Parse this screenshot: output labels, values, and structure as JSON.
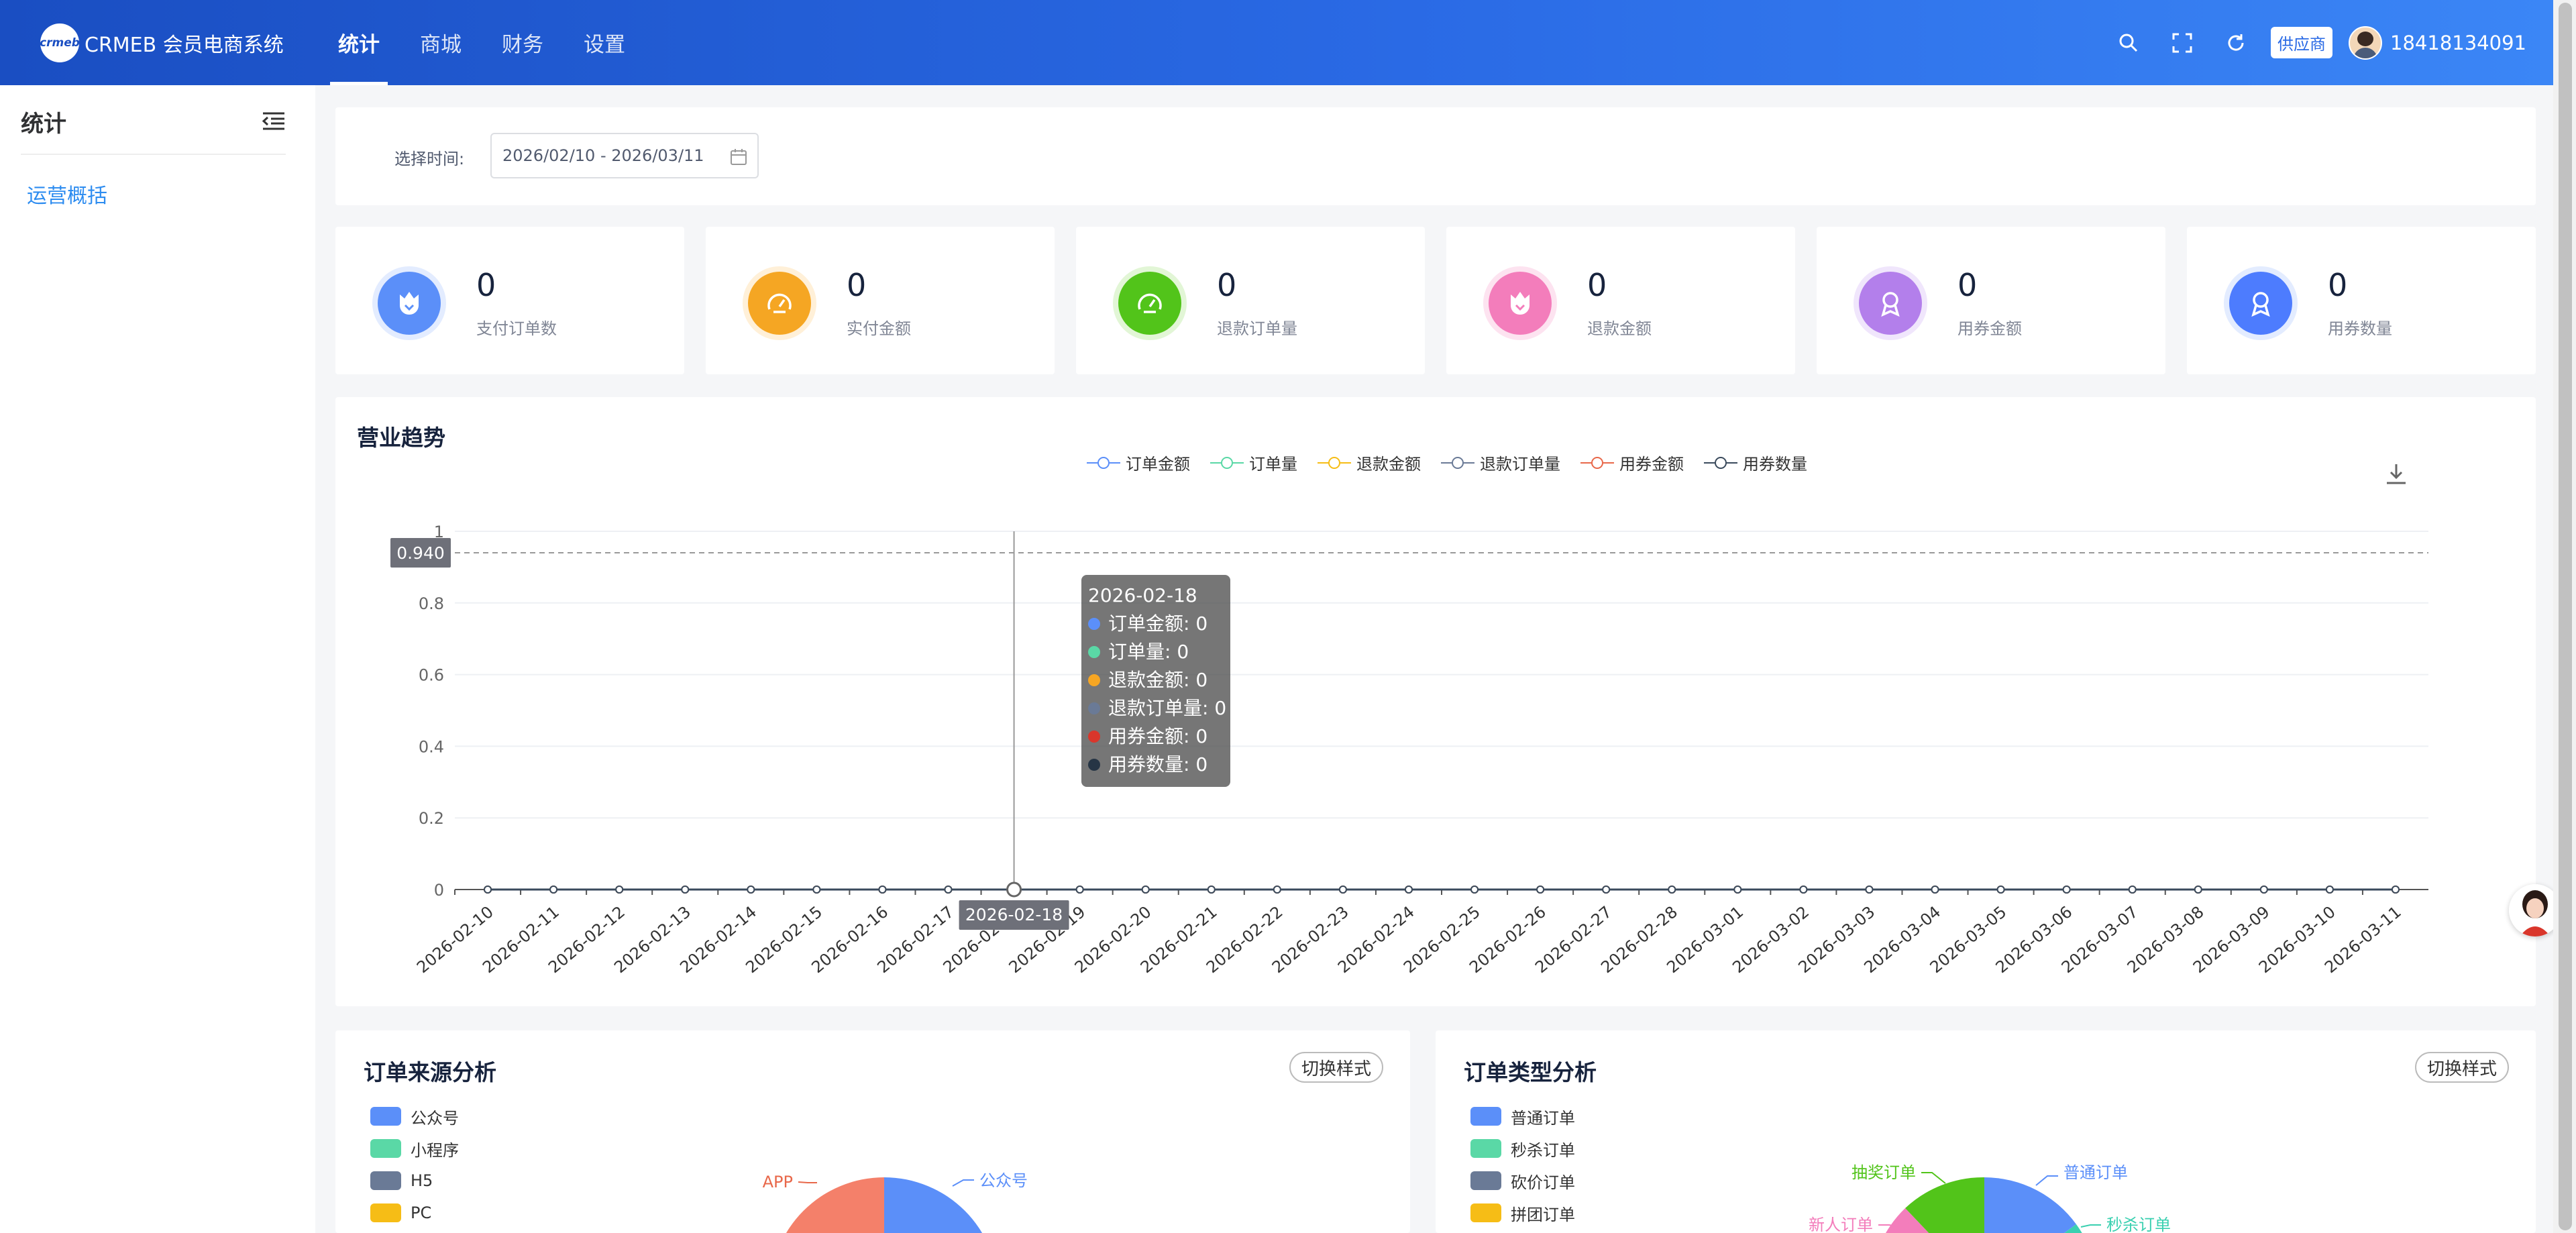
{
  "header": {
    "logo_badge": "crmeb",
    "logo_text": "CRMEB 会员电商系统",
    "nav": [
      {
        "label": "统计",
        "active": true
      },
      {
        "label": "商城",
        "active": false
      },
      {
        "label": "财务",
        "active": false
      },
      {
        "label": "设置",
        "active": false
      }
    ],
    "supplier_label": "供应商",
    "user_phone": "18418134091",
    "icons": [
      "search-icon",
      "fullscreen-icon",
      "refresh-icon"
    ]
  },
  "sidebar": {
    "title": "统计",
    "items": [
      {
        "label": "运营概括"
      }
    ]
  },
  "filter": {
    "label": "选择时间:",
    "date_range": "2026/02/10 - 2026/03/11"
  },
  "stats": [
    {
      "value": "0",
      "label": "支付订单数",
      "color": "#5b8ff9",
      "ring": "#e3ecff",
      "icon": "flower-icon"
    },
    {
      "value": "0",
      "label": "实付金额",
      "color": "#f5a623",
      "ring": "#fff0d8",
      "icon": "gauge-icon"
    },
    {
      "value": "0",
      "label": "退款订单量",
      "color": "#52c41a",
      "ring": "#e2f6d6",
      "icon": "gauge-icon"
    },
    {
      "value": "0",
      "label": "退款金额",
      "color": "#f37dbb",
      "ring": "#fde3f0",
      "icon": "flower-icon"
    },
    {
      "value": "0",
      "label": "用券金额",
      "color": "#b37feb",
      "ring": "#f0e6fc",
      "icon": "medal-icon"
    },
    {
      "value": "0",
      "label": "用券数量",
      "color": "#4d7cfe",
      "ring": "#e3ecff",
      "icon": "medal-icon"
    }
  ],
  "trend": {
    "title": "营业趋势",
    "legend": [
      {
        "name": "订单金额",
        "color": "#5b8ff9"
      },
      {
        "name": "订单量",
        "color": "#5ad8a6"
      },
      {
        "name": "退款金额",
        "color": "#f6bd16"
      },
      {
        "name": "退款订单量",
        "color": "#6a7a96"
      },
      {
        "name": "用券金额",
        "color": "#e8684a"
      },
      {
        "name": "用券数量",
        "color": "#3a4a5c"
      }
    ],
    "pointer_value": "0.940",
    "pointer_date": "2026-02-18",
    "tooltip": {
      "date": "2026-02-18",
      "rows": [
        {
          "text": "订单金额: 0",
          "color": "#5b8ff9"
        },
        {
          "text": "订单量: 0",
          "color": "#5ad8a6"
        },
        {
          "text": "退款金额: 0",
          "color": "#f6a623"
        },
        {
          "text": "退款订单量: 0",
          "color": "#6a7a96"
        },
        {
          "text": "用券金额: 0",
          "color": "#d9362b"
        },
        {
          "text": "用券数量: 0",
          "color": "#263545"
        }
      ]
    }
  },
  "chart_data": {
    "type": "line",
    "x": [
      "2026-02-10",
      "2026-02-11",
      "2026-02-12",
      "2026-02-13",
      "2026-02-14",
      "2026-02-15",
      "2026-02-16",
      "2026-02-17",
      "2026-02-18",
      "2026-02-19",
      "2026-02-20",
      "2026-02-21",
      "2026-02-22",
      "2026-02-23",
      "2026-02-24",
      "2026-02-25",
      "2026-02-26",
      "2026-02-27",
      "2026-02-28",
      "2026-03-01",
      "2026-03-02",
      "2026-03-03",
      "2026-03-04",
      "2026-03-05",
      "2026-03-06",
      "2026-03-07",
      "2026-03-08",
      "2026-03-09",
      "2026-03-10",
      "2026-03-11"
    ],
    "series": [
      {
        "name": "订单金额",
        "values": [
          0,
          0,
          0,
          0,
          0,
          0,
          0,
          0,
          0,
          0,
          0,
          0,
          0,
          0,
          0,
          0,
          0,
          0,
          0,
          0,
          0,
          0,
          0,
          0,
          0,
          0,
          0,
          0,
          0,
          0
        ]
      },
      {
        "name": "订单量",
        "values": [
          0,
          0,
          0,
          0,
          0,
          0,
          0,
          0,
          0,
          0,
          0,
          0,
          0,
          0,
          0,
          0,
          0,
          0,
          0,
          0,
          0,
          0,
          0,
          0,
          0,
          0,
          0,
          0,
          0,
          0
        ]
      },
      {
        "name": "退款金额",
        "values": [
          0,
          0,
          0,
          0,
          0,
          0,
          0,
          0,
          0,
          0,
          0,
          0,
          0,
          0,
          0,
          0,
          0,
          0,
          0,
          0,
          0,
          0,
          0,
          0,
          0,
          0,
          0,
          0,
          0,
          0
        ]
      },
      {
        "name": "退款订单量",
        "values": [
          0,
          0,
          0,
          0,
          0,
          0,
          0,
          0,
          0,
          0,
          0,
          0,
          0,
          0,
          0,
          0,
          0,
          0,
          0,
          0,
          0,
          0,
          0,
          0,
          0,
          0,
          0,
          0,
          0,
          0
        ]
      },
      {
        "name": "用券金额",
        "values": [
          0,
          0,
          0,
          0,
          0,
          0,
          0,
          0,
          0,
          0,
          0,
          0,
          0,
          0,
          0,
          0,
          0,
          0,
          0,
          0,
          0,
          0,
          0,
          0,
          0,
          0,
          0,
          0,
          0,
          0
        ]
      },
      {
        "name": "用券数量",
        "values": [
          0,
          0,
          0,
          0,
          0,
          0,
          0,
          0,
          0,
          0,
          0,
          0,
          0,
          0,
          0,
          0,
          0,
          0,
          0,
          0,
          0,
          0,
          0,
          0,
          0,
          0,
          0,
          0,
          0,
          0
        ]
      }
    ],
    "yticks": [
      "0",
      "0.2",
      "0.4",
      "0.6",
      "0.8",
      "1"
    ],
    "ylim": [
      0,
      1
    ],
    "grid": true,
    "legend": "top"
  },
  "source": {
    "title": "订单来源分析",
    "switch_label": "切换样式",
    "legend": [
      {
        "name": "公众号",
        "color": "#5b8ff9"
      },
      {
        "name": "小程序",
        "color": "#5ad8a6"
      },
      {
        "name": "H5",
        "color": "#6a7a96"
      },
      {
        "name": "PC",
        "color": "#f6bd16"
      }
    ],
    "pie_labels": [
      {
        "name": "APP",
        "color": "#e8684a"
      },
      {
        "name": "公众号",
        "color": "#5b8ff9"
      }
    ]
  },
  "type_analysis": {
    "title": "订单类型分析",
    "switch_label": "切换样式",
    "legend": [
      {
        "name": "普通订单",
        "color": "#5b8ff9"
      },
      {
        "name": "秒杀订单",
        "color": "#5ad8a6"
      },
      {
        "name": "砍价订单",
        "color": "#6a7a96"
      },
      {
        "name": "拼团订单",
        "color": "#f6bd16"
      }
    ],
    "pie_labels": [
      {
        "name": "抽奖订单",
        "color": "#52c41a"
      },
      {
        "name": "普通订单",
        "color": "#5b8ff9"
      },
      {
        "name": "新人订单",
        "color": "#f37dbb"
      },
      {
        "name": "秒杀订单",
        "color": "#3ad0b0"
      }
    ]
  }
}
